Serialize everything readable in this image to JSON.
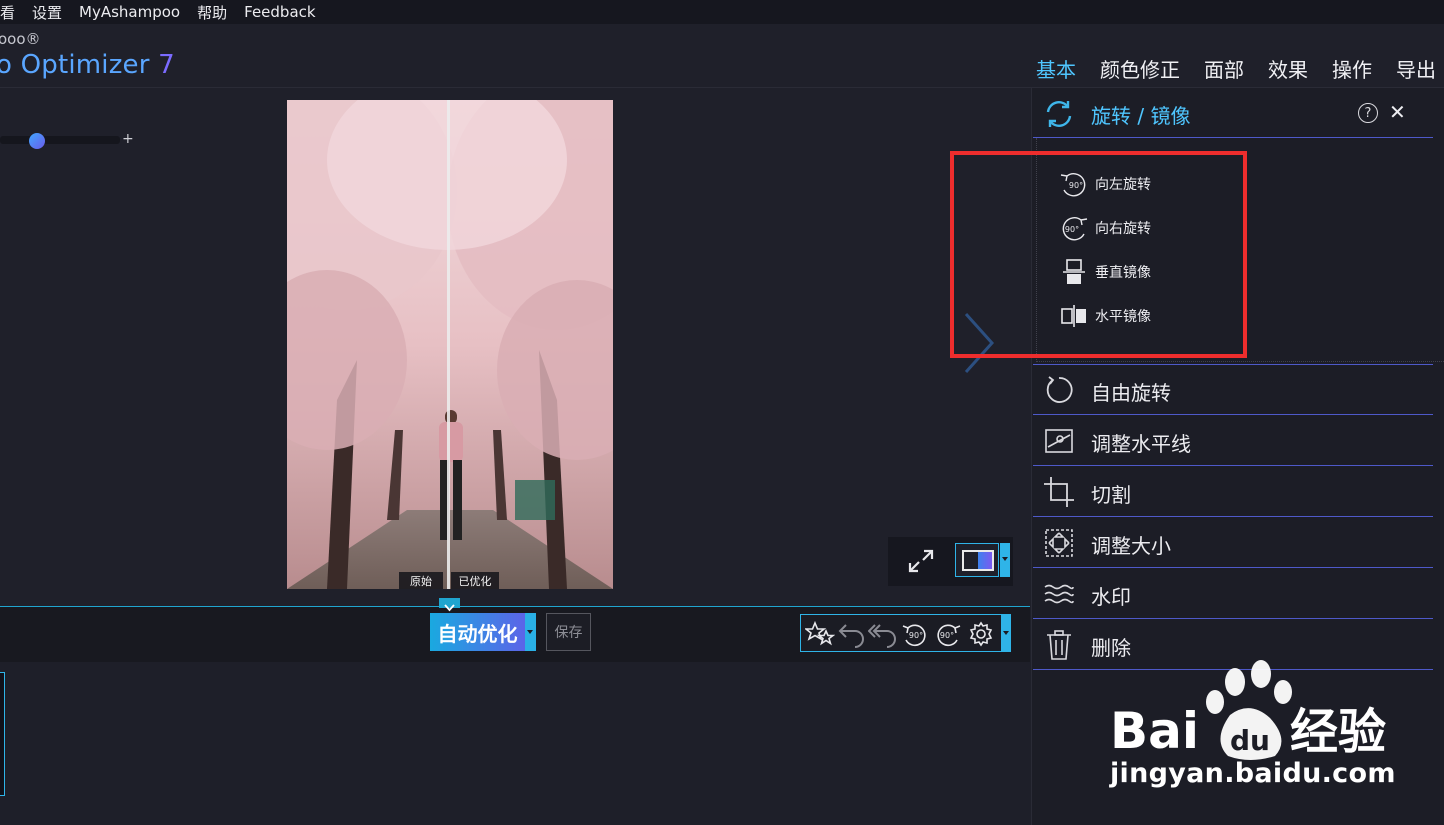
{
  "menu": {
    "items": [
      "看",
      "设置",
      "MyAshampoo",
      "帮助",
      "Feedback"
    ]
  },
  "brand": {
    "small": "ooo®",
    "big": "o Optimizer",
    "version": "7"
  },
  "tabs": [
    {
      "label": "基本",
      "active": true
    },
    {
      "label": "颜色修正"
    },
    {
      "label": "面部"
    },
    {
      "label": "效果"
    },
    {
      "label": "操作"
    },
    {
      "label": "导出"
    }
  ],
  "zoom": {
    "plus": "+",
    "level": 0.25
  },
  "photo": {
    "original_label": "原始",
    "optimized_label": "已优化"
  },
  "toolbar": {
    "auto_label": "自动优化",
    "save_label": "保存"
  },
  "panel": {
    "header": {
      "title": "旋转 / 镜像",
      "help": "?",
      "close": "✕"
    },
    "sub_items": [
      {
        "label": "向左旋转",
        "icon": "rotate-left-90-icon"
      },
      {
        "label": "向右旋转",
        "icon": "rotate-right-90-icon"
      },
      {
        "label": "垂直镜像",
        "icon": "flip-vertical-icon"
      },
      {
        "label": "水平镜像",
        "icon": "flip-horizontal-icon"
      }
    ],
    "items": [
      {
        "label": "自由旋转",
        "icon": "free-rotate-icon"
      },
      {
        "label": "调整水平线",
        "icon": "horizon-icon"
      },
      {
        "label": "切割",
        "icon": "crop-icon"
      },
      {
        "label": "调整大小",
        "icon": "resize-icon"
      },
      {
        "label": "水印",
        "icon": "watermark-icon"
      },
      {
        "label": "删除",
        "icon": "trash-icon"
      }
    ]
  },
  "watermark": {
    "brand": "Bai经验",
    "url": "jingyan.baidu.com"
  },
  "colors": {
    "accent": "#2fb4e8",
    "highlight": "#ee2d2d",
    "panel_divider": "#4e59c9"
  }
}
